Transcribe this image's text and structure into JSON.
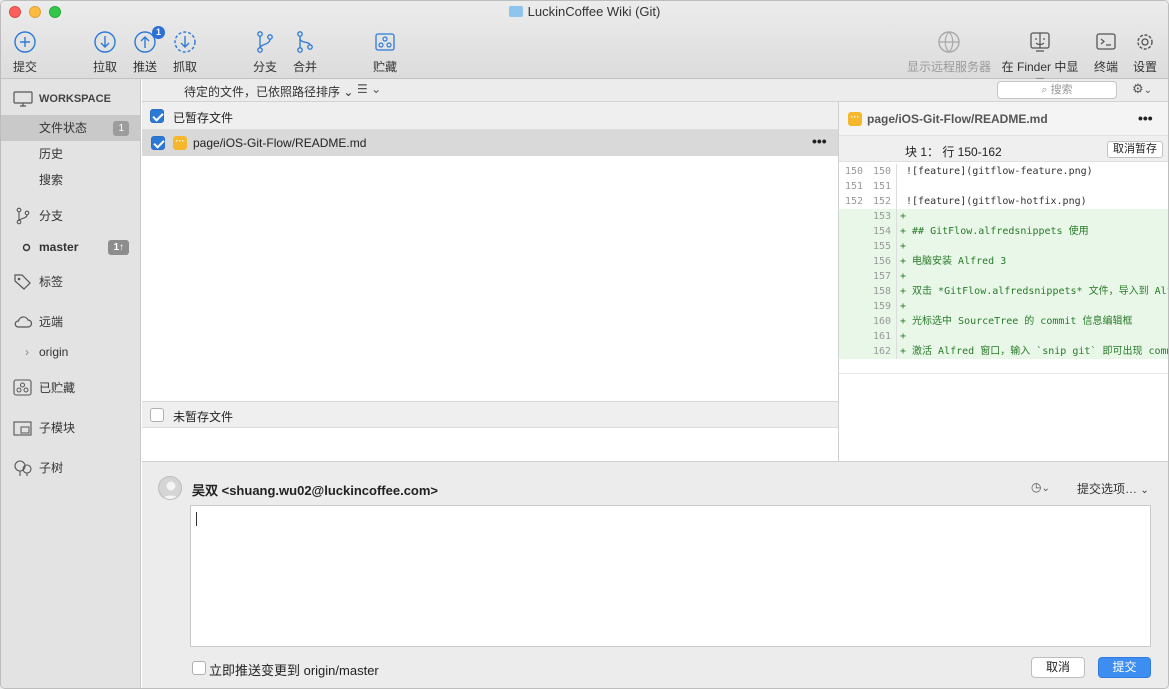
{
  "window": {
    "title": "LuckinCoffee Wiki (Git)"
  },
  "toolbar": {
    "commit": "提交",
    "pull": "拉取",
    "push": "推送",
    "push_badge": "1",
    "fetch": "抓取",
    "branch": "分支",
    "merge": "合并",
    "stash": "贮藏",
    "show_remote": "显示远程服务器",
    "show_in_finder": "在 Finder 中显示",
    "terminal": "终端",
    "settings": "设置"
  },
  "sidebar": {
    "workspace": "WORKSPACE",
    "file_status": "文件状态",
    "file_status_count": "1",
    "history": "历史",
    "search": "搜索",
    "branches": "分支",
    "branch_master": "master",
    "branch_master_badge": "1↑",
    "tags": "标签",
    "remotes": "远端",
    "remote_origin": "origin",
    "stashes": "已贮藏",
    "submodules": "子模块",
    "subtrees": "子树"
  },
  "filterbar": {
    "filter": "待定的文件，已依照路径排序",
    "search_placeholder": "搜索"
  },
  "staged": {
    "header": "已暂存文件",
    "files": [
      {
        "path": "page/iOS-Git-Flow/README.md"
      }
    ]
  },
  "unstaged": {
    "header": "未暂存文件"
  },
  "diff": {
    "file": "page/iOS-Git-Flow/README.md",
    "hunk": "块 1： 行 150-162",
    "unstage_button": "取消暂存",
    "lines": [
      {
        "old": "150",
        "new": "150",
        "text": " ![feature](gitflow-feature.png)",
        "add": false
      },
      {
        "old": "151",
        "new": "151",
        "text": " ",
        "add": false
      },
      {
        "old": "152",
        "new": "152",
        "text": " ![feature](gitflow-hotfix.png)",
        "add": false
      },
      {
        "old": "",
        "new": "153",
        "text": "+",
        "add": true
      },
      {
        "old": "",
        "new": "154",
        "text": "+ ## GitFlow.alfredsnippets 使用",
        "add": true
      },
      {
        "old": "",
        "new": "155",
        "text": "+",
        "add": true
      },
      {
        "old": "",
        "new": "156",
        "text": "+ 电脑安装 Alfred 3",
        "add": true
      },
      {
        "old": "",
        "new": "157",
        "text": "+",
        "add": true
      },
      {
        "old": "",
        "new": "158",
        "text": "+ 双击 *GitFlow.alfredsnippets* 文件，导入到 Alfred",
        "add": true
      },
      {
        "old": "",
        "new": "159",
        "text": "+",
        "add": true
      },
      {
        "old": "",
        "new": "160",
        "text": "+ 光标选中 SourceTree 的 commit 信息编辑框",
        "add": true
      },
      {
        "old": "",
        "new": "161",
        "text": "+",
        "add": true
      },
      {
        "old": "",
        "new": "162",
        "text": "+ 激活 Alfred 窗口，输入 `snip git` 即可出现 commit",
        "add": true
      }
    ]
  },
  "commit": {
    "author": "吴双 <shuang.wu02@luckincoffee.com>",
    "options": "提交选项…",
    "push_immediately": "立即推送变更到 origin/master",
    "cancel": "取消",
    "submit": "提交"
  },
  "colors": {
    "accent": "#3d8ef0",
    "added_bg": "#e8f7e8",
    "modified": "#f5b72b"
  }
}
